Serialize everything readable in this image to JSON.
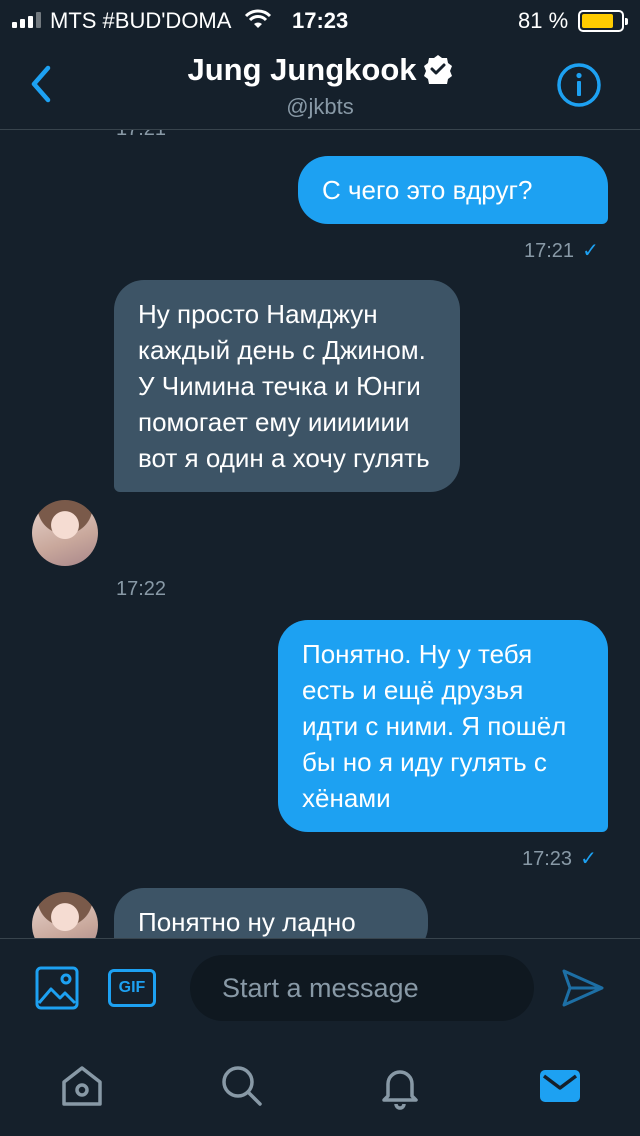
{
  "status": {
    "carrier": "MTS #BUD'DOMA",
    "time": "17:23",
    "battery_percent": "81 %",
    "battery_level": 0.81
  },
  "header": {
    "title": "Jung Jungkook",
    "handle": "@jkbts"
  },
  "messages": {
    "cut_timestamp": "17:21",
    "items": [
      {
        "direction": "out",
        "text": "С чего это вдруг?",
        "time": "17:21",
        "read_mark": "✓"
      },
      {
        "direction": "in",
        "text": "Ну просто Намджун каждый день с Джином. У Чимина течка и Юнги помогает ему иииииии вот я один а хочу гулять",
        "time": "17:22"
      },
      {
        "direction": "out",
        "text": "Понятно. Ну у тебя есть и ещё друзья идти с ними. Я пошёл бы но я иду гулять с хёнами",
        "time": "17:23",
        "read_mark": "✓"
      },
      {
        "direction": "in",
        "text": "Понятно ну ладно"
      }
    ]
  },
  "composer": {
    "gif_label": "GIF",
    "placeholder": "Start a message"
  },
  "colors": {
    "background": "#15202b",
    "accent": "#1da1f2",
    "incoming_bubble": "#3d5466",
    "secondary_text": "#8899a6"
  },
  "icons": [
    "back-chevron-icon",
    "verified-badge-icon",
    "info-icon",
    "image-icon",
    "send-icon",
    "home-icon",
    "search-icon",
    "notifications-bell-icon",
    "mail-icon"
  ]
}
